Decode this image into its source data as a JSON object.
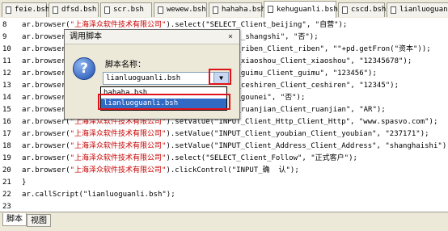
{
  "tabs": [
    {
      "label": "feie.bsh",
      "active": false
    },
    {
      "label": "dfsd.bsh",
      "active": false
    },
    {
      "label": "scr.bsh",
      "active": false
    },
    {
      "label": "wewew.bsh",
      "active": false
    },
    {
      "label": "hahaha.bsh",
      "active": false
    },
    {
      "label": "kehuguanli.bsh",
      "active": true
    },
    {
      "label": "cscd.bsh",
      "active": false
    },
    {
      "label": "lianluoguanli.bsh",
      "active": false
    }
  ],
  "code_lines": [
    {
      "num": "8",
      "pre": "ar.browser(",
      "str1": "\"上海泽众软件技术有限公司\"",
      "post": ").select(\"SELECT_Client_beijing\", \"自营\");"
    },
    {
      "num": "9",
      "pre": "ar.browser(",
      "str1": "",
      "post": "                                   ient_shangshi\", \"否\");"
    },
    {
      "num": "10",
      "pre": "ar.browser",
      "str1": "",
      "post": "                                   ient_riben_Client_riben\", \"\"+pd.getFron(\"资本\"));"
    },
    {
      "num": "11",
      "pre": "ar.browser",
      "str1": "",
      "post": "                                   ient_xiaoshou_Client_xiaoshou\", \"12345678\");"
    },
    {
      "num": "12",
      "pre": "ar.browser",
      "str1": "",
      "post": "                                   ient_guimu_Client_guimu\", \"123456\");"
    },
    {
      "num": "13",
      "pre": "ar.browser",
      "str1": "",
      "post": "                                   ient_ceshiren_Client_ceshiren\", \"12345\");"
    },
    {
      "num": "14",
      "pre": "ar.browser",
      "str1": "",
      "post": "                                   ient_gounei\", \"否\");"
    },
    {
      "num": "15",
      "pre": "ar.browser",
      "str1": "",
      "post": "                                   ient_ruanjian_Client_ruanjian\", \"AR\");"
    },
    {
      "num": "16",
      "pre": "ar.browser(",
      "str1": "\"上海泽众软件技术有限公司\"",
      "post": ").setValue(\"INPUT_Client_Http_Client_Http\", \"www.spasvo.com\");"
    },
    {
      "num": "17",
      "pre": "ar.browser(",
      "str1": "\"上海泽众软件技术有限公司\"",
      "post": ").setValue(\"INPUT_Client_youbian_Client_youbian\", \"237171\");"
    },
    {
      "num": "18",
      "pre": "ar.browser(",
      "str1": "\"上海泽众软件技术有限公司\"",
      "post": ").setValue(\"INPUT_Client_Address_Client_Address\", \"shanghaishi\");"
    },
    {
      "num": "19",
      "pre": "ar.browser(",
      "str1": "\"上海泽众软件技术有限公司\"",
      "post": ").select(\"SELECT_Client_Follow\", \"正式客户\");"
    },
    {
      "num": "20",
      "pre": "ar.browser(",
      "str1": "\"上海泽众软件技术有限公司\"",
      "post": ").clickControl(\"INPUT_确  认\");"
    },
    {
      "num": "21",
      "pre": "}",
      "str1": "",
      "post": ""
    },
    {
      "num": "22",
      "pre": "ar.callScript(\"lianluoguanli.bsh\");",
      "str1": "",
      "post": ""
    },
    {
      "num": "23",
      "pre": "",
      "str1": "",
      "post": ""
    }
  ],
  "dialog": {
    "title": "调用脚本",
    "close": "×",
    "icon": "question-icon",
    "label": "脚本名称：",
    "combo_value": "lianluoguanli.bsh",
    "combo_arrow": "▼",
    "options": [
      {
        "label": "hahaha.bsh",
        "selected": false
      },
      {
        "label": "lianluoguanli.bsh",
        "selected": true
      }
    ]
  },
  "bottom_tabs": [
    {
      "label": "脚本",
      "active": true
    },
    {
      "label": "视图",
      "active": false
    }
  ],
  "colors": {
    "highlight": "#e0131b",
    "string": "#c80000",
    "selection": "#316ac5"
  }
}
